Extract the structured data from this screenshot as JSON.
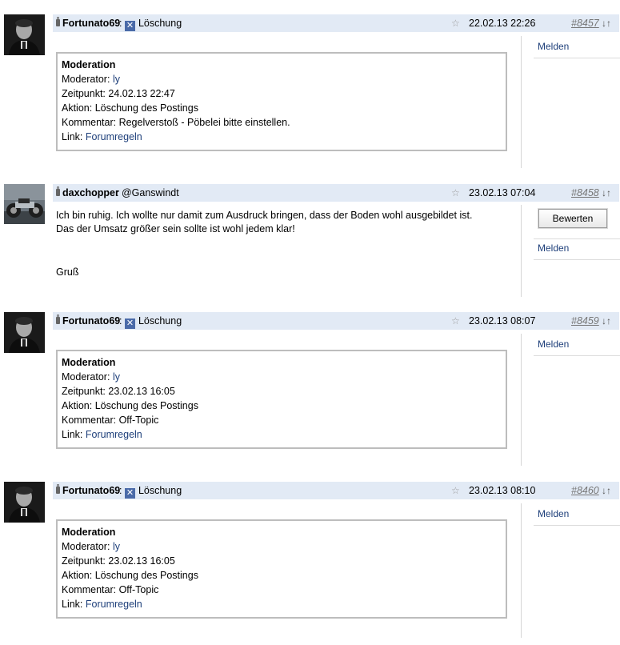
{
  "posts": [
    {
      "author": "Fortunato69",
      "title": "Löschung",
      "date": "22.02.13 22:26",
      "number": "#8457",
      "arrows": "↓↑",
      "report": "Melden",
      "moderation": {
        "heading": "Moderation",
        "moderator_label": "Moderator:",
        "moderator": "ly",
        "time_label": "Zeitpunkt:",
        "time": "24.02.13 22:47",
        "action_label": "Aktion:",
        "action": "Löschung des Postings",
        "comment_label": "Kommentar:",
        "comment": "Regelverstoß - Pöbelei bitte einstellen.",
        "link_label": "Link:",
        "link": "Forumregeln"
      }
    },
    {
      "author": "daxchopper",
      "title": "@Ganswindt",
      "date": "23.02.13 07:04",
      "number": "#8458",
      "arrows": "↓↑",
      "rate": "Bewerten",
      "report": "Melden",
      "body": {
        "line1": "Ich bin ruhig. Ich wollte nur damit zum Ausdruck bringen, dass der Boden wohl ausgebildet ist.",
        "line2": "Das der Umsatz größer sein sollte ist wohl jedem klar!",
        "line3": "Gruß"
      }
    },
    {
      "author": "Fortunato69",
      "title": "Löschung",
      "date": "23.02.13 08:07",
      "number": "#8459",
      "arrows": "↓↑",
      "report": "Melden",
      "moderation": {
        "heading": "Moderation",
        "moderator_label": "Moderator:",
        "moderator": "ly",
        "time_label": "Zeitpunkt:",
        "time": "23.02.13 16:05",
        "action_label": "Aktion:",
        "action": "Löschung des Postings",
        "comment_label": "Kommentar:",
        "comment": "Off-Topic",
        "link_label": "Link:",
        "link": "Forumregeln"
      }
    },
    {
      "author": "Fortunato69",
      "title": "Löschung",
      "date": "23.02.13 08:10",
      "number": "#8460",
      "arrows": "↓↑",
      "report": "Melden",
      "moderation": {
        "heading": "Moderation",
        "moderator_label": "Moderator:",
        "moderator": "ly",
        "time_label": "Zeitpunkt:",
        "time": "23.02.13 16:05",
        "action_label": "Aktion:",
        "action": "Löschung des Postings",
        "comment_label": "Kommentar:",
        "comment": "Off-Topic",
        "link_label": "Link:",
        "link": "Forumregeln"
      }
    }
  ],
  "colors": {
    "header_bg": "#e2eaf5",
    "link": "#1e3f7a"
  }
}
